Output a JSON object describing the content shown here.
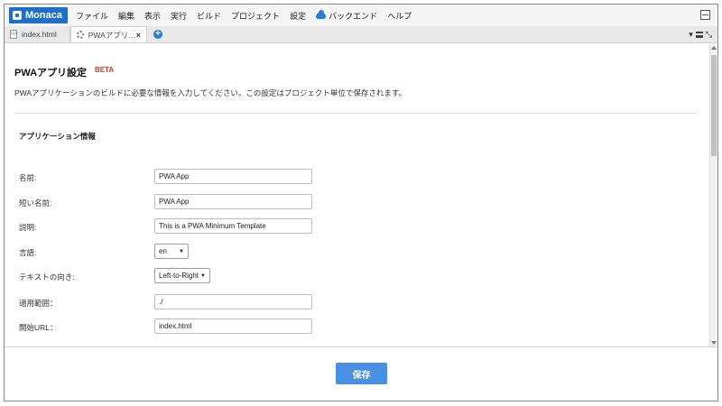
{
  "menubar": {
    "logo": "Monaca",
    "items": [
      "ファイル",
      "編集",
      "表示",
      "実行",
      "ビルド",
      "プロジェクト",
      "設定"
    ],
    "backend": "バックエンド",
    "help": "ヘルプ"
  },
  "tabs": [
    {
      "label": "index.html",
      "icon": "file-icon",
      "active": false
    },
    {
      "label": "PWAアプリ…",
      "icon": "gear-icon",
      "active": true,
      "close": "×"
    }
  ],
  "page": {
    "title": "PWAアプリ設定",
    "badge": "BETA",
    "description": "PWAアプリケーションのビルドに必要な情報を入力してください。この設定はプロジェクト単位で保存されます。",
    "section": "アプリケーション情報"
  },
  "fields": {
    "name": {
      "label": "名前:",
      "value": "PWA App"
    },
    "short_name": {
      "label": "短い名前:",
      "value": "PWA App"
    },
    "description": {
      "label": "説明:",
      "value": "This is a PWA Minimum Template"
    },
    "language": {
      "label": "言語:",
      "value": "en"
    },
    "text_direction": {
      "label": "テキストの向き:",
      "value": "Left-to-Right"
    },
    "scope": {
      "label": "適用範囲：",
      "value": "./"
    },
    "start_url": {
      "label": "開始URL：",
      "value": "index.html"
    }
  },
  "footer": {
    "save_label": "保存"
  },
  "colors": {
    "brand": "#1f6fc6",
    "beta": "#c5402d",
    "save": "#4a90e2"
  }
}
